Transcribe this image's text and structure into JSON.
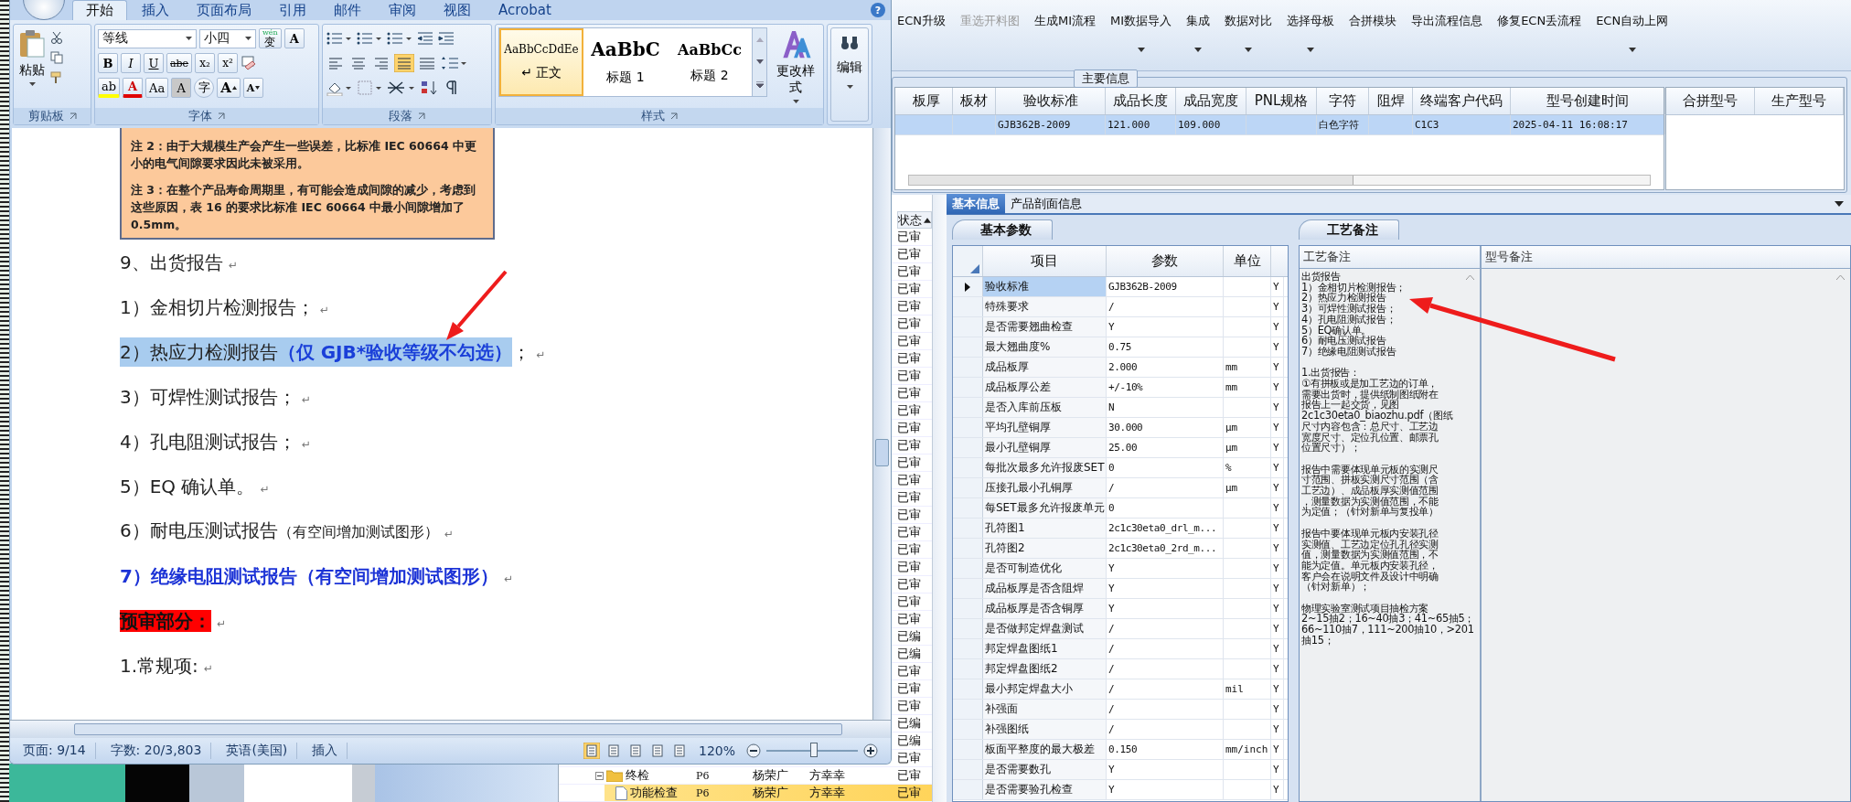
{
  "word": {
    "tabs": [
      {
        "label": "开始",
        "selected": true
      },
      {
        "label": "插入",
        "selected": false
      },
      {
        "label": "页面布局",
        "selected": false
      },
      {
        "label": "引用",
        "selected": false
      },
      {
        "label": "邮件",
        "selected": false
      },
      {
        "label": "审阅",
        "selected": false
      },
      {
        "label": "视图",
        "selected": false
      },
      {
        "label": "Acrobat",
        "selected": false
      }
    ],
    "help": "?",
    "clipboard": {
      "paste": "粘贴",
      "label": "剪贴板"
    },
    "font": {
      "name": "等线",
      "size": "小四",
      "phonetic": {
        "top": "wén",
        "main": "变"
      },
      "border_char": "A",
      "format_buttons": [
        "B",
        "I",
        "U",
        "abe",
        "x₂",
        "x²"
      ],
      "effect_buttons": [
        {
          "kind": "highlighter",
          "text": "ab"
        },
        {
          "kind": "font_color",
          "text": "A"
        },
        {
          "kind": "case",
          "text": "Aa"
        },
        {
          "kind": "shaded",
          "text": "A"
        },
        {
          "kind": "circled",
          "text": "字"
        },
        {
          "kind": "grow",
          "text": "A"
        },
        {
          "kind": "shrink",
          "text": "A"
        }
      ],
      "label": "字体"
    },
    "paragraph": {
      "align_buttons": [
        {
          "selected": false
        },
        {
          "selected": false
        },
        {
          "selected": false
        },
        {
          "selected": true
        },
        {
          "selected": false
        }
      ],
      "label": "段落"
    },
    "styles": {
      "items": [
        {
          "preview": "AaBbCcDdEe",
          "mark": "↵",
          "name": "正文",
          "selected": true
        },
        {
          "preview": "AaBbC",
          "name": "标题 1",
          "selected": false
        },
        {
          "preview": "AaBbCc",
          "name": "标题 2",
          "selected": false
        }
      ],
      "change": "更改样式",
      "label": "样式"
    },
    "editing": {
      "label": "编辑"
    },
    "document": {
      "notes": [
        "注 2：由于大规模生产会产生一些误差，比标准 IEC 60664 中更小的电气间隙要求因此未被采用。",
        "注 3：在整个产品寿命周期里，有可能会造成间隙的减少，考虑到这些原因，表 16 的要求比标准 IEC 60664 中最小间隙增加了 0.5mm。"
      ],
      "paragraphs": [
        {
          "kind": "normal",
          "parts": [
            {
              "text": "9、出货报告",
              "kind": "plain",
              "highlighted": false
            }
          ],
          "mark": "↵"
        },
        {
          "kind": "normal",
          "parts": [
            {
              "text": "1）金相切片检测报告；",
              "kind": "plain",
              "highlighted": false
            }
          ],
          "mark": "↵"
        },
        {
          "kind": "normal",
          "parts": [
            {
              "text": "2）热应力检测报告",
              "kind": "plain",
              "highlighted": true
            },
            {
              "text": "（仅 GJB*验收等级不勾选）",
              "kind": "bold_blue",
              "highlighted": true
            },
            {
              "text": "；",
              "kind": "plain",
              "highlighted": false
            }
          ],
          "mark": "↵"
        },
        {
          "kind": "normal",
          "parts": [
            {
              "text": "3）可焊性测试报告；",
              "kind": "plain",
              "highlighted": false
            }
          ],
          "mark": "↵"
        },
        {
          "kind": "normal",
          "parts": [
            {
              "text": "4）孔电阻测试报告；",
              "kind": "plain",
              "highlighted": false
            }
          ],
          "mark": "↵"
        },
        {
          "kind": "normal",
          "parts": [
            {
              "text": "5）EQ 确认单。",
              "kind": "plain",
              "highlighted": false
            }
          ],
          "mark": "↵"
        },
        {
          "kind": "normal",
          "parts": [
            {
              "text": "6）耐电压测试报告",
              "kind": "plain",
              "highlighted": false
            },
            {
              "text": "（有空间增加测试图形）",
              "kind": "small",
              "highlighted": false
            }
          ],
          "mark": "↵"
        },
        {
          "kind": "heading",
          "parts": [
            {
              "text": "7）绝缘电阻测试报告（有空间增加测试图形）",
              "kind": "plain",
              "highlighted": false
            }
          ],
          "mark": "↵"
        },
        {
          "kind": "label",
          "parts": [
            {
              "text": "预审部分：",
              "kind": "plain",
              "highlighted": false
            }
          ],
          "mark": "↵"
        },
        {
          "kind": "normal",
          "parts": [
            {
              "text": "1.常规项:",
              "kind": "plain",
              "highlighted": false
            }
          ],
          "mark": "↵"
        }
      ]
    },
    "status_bar": {
      "page": "页面: 9/14",
      "words": "字数: 20/3,803",
      "language": "英语(美国)",
      "mode": "插入",
      "views": [
        {
          "selected": true
        },
        {
          "selected": false
        },
        {
          "selected": false
        },
        {
          "selected": false
        },
        {
          "selected": false
        }
      ],
      "zoom": "120%",
      "zoom_slider": {
        "level": 0.52
      }
    }
  },
  "toolbar": [
    {
      "label": "ECN升级",
      "dropdown": false,
      "disabled": false
    },
    {
      "label": "重选开料图",
      "dropdown": false,
      "disabled": true
    },
    {
      "label": "生成MI流程",
      "dropdown": false,
      "disabled": false
    },
    {
      "label": "MI数据导入",
      "dropdown": true,
      "disabled": false
    },
    {
      "label": "集成",
      "dropdown": true,
      "disabled": false
    },
    {
      "label": "数据对比",
      "dropdown": true,
      "disabled": false
    },
    {
      "label": "选择母板",
      "dropdown": true,
      "disabled": false
    },
    {
      "label": "合拼模块",
      "dropdown": false,
      "disabled": false
    },
    {
      "label": "导出流程信息",
      "dropdown": false,
      "disabled": false
    },
    {
      "label": "修复ECN丢流程",
      "dropdown": false,
      "disabled": false
    },
    {
      "label": "ECN自动上网",
      "dropdown": true,
      "disabled": false
    }
  ],
  "main_info": {
    "legend": "主要信息",
    "columns": [
      "板厚",
      "板材",
      "验收标准",
      "成品长度",
      "成品宽度",
      "PNL规格",
      "字符",
      "阻焊",
      "终端客户代码",
      "型号创建时间"
    ],
    "rows": [
      {
        "selected": true,
        "cells": [
          null,
          null,
          "GJB362B-2009",
          "121.000",
          "109.000",
          null,
          "白色字符",
          null,
          "C1C3",
          "2025-04-11 16:08:17"
        ]
      }
    ],
    "side_columns": [
      "合拼型号",
      "生产型号"
    ]
  },
  "task_list": {
    "header": "状态",
    "rows": [
      {
        "status": "已审",
        "selected": false
      },
      {
        "status": "已审",
        "selected": false
      },
      {
        "status": "已审",
        "selected": false
      },
      {
        "status": "已审",
        "selected": false
      },
      {
        "status": "已审",
        "selected": false
      },
      {
        "status": "已审",
        "selected": false
      },
      {
        "status": "已审",
        "selected": false
      },
      {
        "status": "已审",
        "selected": false
      },
      {
        "status": "已审",
        "selected": false
      },
      {
        "status": "已审",
        "selected": false
      },
      {
        "status": "已审",
        "selected": false
      },
      {
        "status": "已审",
        "selected": false
      },
      {
        "status": "已审",
        "selected": false
      },
      {
        "status": "已审",
        "selected": false
      },
      {
        "status": "已审",
        "selected": false
      },
      {
        "status": "已审",
        "selected": false
      },
      {
        "status": "已审",
        "selected": false
      },
      {
        "status": "已审",
        "selected": false
      },
      {
        "status": "已审",
        "selected": false
      },
      {
        "status": "已审",
        "selected": false
      },
      {
        "status": "已审",
        "selected": false
      },
      {
        "status": "已审",
        "selected": false
      },
      {
        "status": "已审",
        "selected": false
      },
      {
        "status": "已编",
        "selected": false
      },
      {
        "status": "已编",
        "selected": false
      },
      {
        "status": "已审",
        "selected": false
      },
      {
        "status": "已审",
        "selected": false
      },
      {
        "status": "已审",
        "selected": false
      },
      {
        "status": "已编",
        "selected": false
      },
      {
        "status": "已编",
        "selected": false
      },
      {
        "status": "已审",
        "selected": false
      },
      {
        "name": "终检",
        "col_2": "P6",
        "col_3": "杨荣广",
        "col_4": "方幸幸",
        "status": "已审",
        "selected": false,
        "expanded": true,
        "children": [
          {
            "name": "功能检查",
            "col_2": "P6",
            "col_3": "杨荣广",
            "col_4": "方幸幸",
            "status": "已审",
            "selected": true
          }
        ]
      }
    ]
  },
  "detail_tabs": [
    {
      "label": "基本信息",
      "selected": true
    },
    {
      "label": "产品剖面信息",
      "selected": false
    }
  ],
  "params": {
    "tab": "基本参数",
    "columns": [
      "项目",
      "参数",
      "单位"
    ],
    "rows": [
      {
        "item": "验收标准",
        "value": "GJB362B-2009",
        "flag": "Y",
        "selected": true
      },
      {
        "item": "特殊要求",
        "value": "/",
        "flag": "Y",
        "selected": false
      },
      {
        "item": "是否需要翘曲检查",
        "value": "Y",
        "flag": "Y",
        "selected": false
      },
      {
        "item": "最大翘曲度%",
        "value": "0.75",
        "flag": "Y",
        "selected": false
      },
      {
        "item": "成品板厚",
        "value": "2.000",
        "unit": "mm",
        "flag": "Y",
        "selected": false
      },
      {
        "item": "成品板厚公差",
        "value": "+/-10%",
        "unit": "mm",
        "flag": "Y",
        "selected": false
      },
      {
        "item": "是否入库前压板",
        "value": "N",
        "flag": "Y",
        "selected": false
      },
      {
        "item": "平均孔壁铜厚",
        "value": "30.000",
        "unit": "μm",
        "flag": "Y",
        "selected": false
      },
      {
        "item": "最小孔壁铜厚",
        "value": "25.00",
        "unit": "μm",
        "flag": "Y",
        "selected": false
      },
      {
        "item": "每批次最多允许报废SET",
        "value": "0",
        "unit": "%",
        "flag": "Y",
        "selected": false
      },
      {
        "item": "压接孔最小孔铜厚",
        "value": "/",
        "unit": "μm",
        "flag": "Y",
        "selected": false
      },
      {
        "item": "每SET最多允许报废单元",
        "value": "0",
        "flag": "Y",
        "selected": false
      },
      {
        "item": "孔符图1",
        "value": "2c1c30eta0_drl_m...",
        "flag": "Y",
        "selected": false
      },
      {
        "item": "孔符图2",
        "value": "2c1c30eta0_2rd_m...",
        "flag": "Y",
        "selected": false
      },
      {
        "item": "是否可制造优化",
        "value": "Y",
        "flag": "Y",
        "selected": false
      },
      {
        "item": "成品板厚是否含阻焊",
        "value": "Y",
        "flag": "Y",
        "selected": false
      },
      {
        "item": "成品板厚是否含铜厚",
        "value": "Y",
        "flag": "Y",
        "selected": false
      },
      {
        "item": "是否做邦定焊盘测试",
        "value": "/",
        "flag": "Y",
        "selected": false
      },
      {
        "item": "邦定焊盘图纸1",
        "value": "/",
        "flag": "Y",
        "selected": false
      },
      {
        "item": "邦定焊盘图纸2",
        "value": "/",
        "flag": "Y",
        "selected": false
      },
      {
        "item": "最小邦定焊盘大小",
        "value": "/",
        "unit": "mil",
        "flag": "Y",
        "selected": false
      },
      {
        "item": "补强面",
        "value": "/",
        "flag": "Y",
        "selected": false
      },
      {
        "item": "补强图纸",
        "value": "/",
        "flag": "Y",
        "selected": false
      },
      {
        "item": "板面平整度的最大极差",
        "value": "0.150",
        "unit": "mm/inch",
        "flag": "Y",
        "selected": false
      },
      {
        "item": "是否需要数孔",
        "value": "Y",
        "flag": "Y",
        "selected": false
      },
      {
        "item": "是否需要验孔检查",
        "value": "Y",
        "flag": "Y",
        "selected": false
      }
    ]
  },
  "notes_panel": {
    "tab": "工艺备注",
    "columns": [
      "工艺备注",
      "型号备注"
    ],
    "process_note": [
      [
        "出货报告",
        "1）金相切片检测报告；",
        "2）热应力检测报告",
        "3）可焊性测试报告；",
        "4）孔电阻测试报告；",
        "5）EQ确认单。",
        "6）耐电压测试报告",
        "7）绝缘电阻测试报告"
      ],
      [
        "1.出货报告：",
        "①有拼板或是加工艺边的订单，",
        "需要出货时，提供纸制图纸附在",
        "报告上一起交货，见图",
        "2c1c30eta0_biaozhu.pdf（图纸",
        "尺寸内容包含：总尺寸、工艺边",
        "宽度尺寸、定位孔位置、邮票孔",
        "位置尺寸）；"
      ],
      [
        "报告中需要体现单元板的实测尺",
        "寸范围、拼板实测尺寸范围（含",
        "工艺边）、成品板厚实测值范围",
        "，测量数据为实测值范围，不能",
        "为定值；（针对新单与复投单）"
      ],
      [
        "报告中要体现单元板内安装孔径",
        "实测值、工艺边定位孔孔径实测",
        "值，测量数据为实测值范围，不",
        "能为定值。单元板内安装孔径，",
        "客户会在说明文件及设计中明确",
        "（针对新单）；"
      ],
      [
        "物理实验室测试项目抽检方案",
        "2~15抽2；16~40抽3；41~65抽5；",
        "66~110抽7，111~200抽10，>201",
        "抽15；"
      ]
    ]
  }
}
